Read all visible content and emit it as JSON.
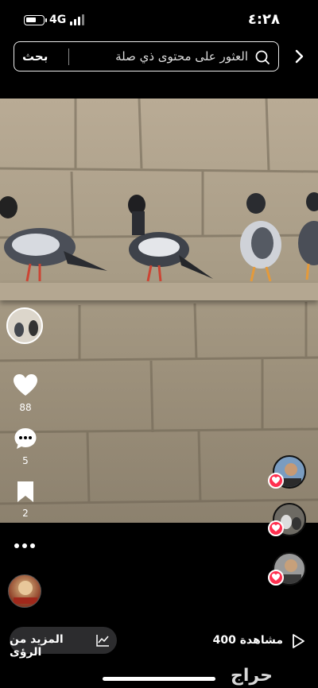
{
  "status_bar": {
    "network": "4G",
    "time": "٤:٢٨"
  },
  "search": {
    "button_label": "بحث",
    "placeholder": "العثور على محتوى ذي صلة"
  },
  "actions": {
    "likes": "88",
    "comments": "5",
    "saves": "2"
  },
  "bottom_bar": {
    "insights_label": "المزيد من الرؤى",
    "views_text": "400 مشاهدة"
  },
  "watermark": "حراج",
  "colors": {
    "like_heart": "#ff3050",
    "background": "#000000",
    "pill": "#2c2c2e"
  },
  "icons": [
    "battery-icon",
    "signal-icon",
    "search-icon",
    "chevron-right-icon",
    "heart-icon",
    "comment-icon",
    "bookmark-icon",
    "more-icon",
    "chart-icon",
    "play-icon"
  ]
}
